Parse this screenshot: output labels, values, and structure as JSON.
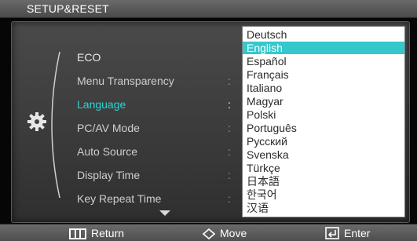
{
  "header": {
    "title": "SETUP&RESET"
  },
  "menu": {
    "items": [
      {
        "label": "ECO"
      },
      {
        "label": "Menu Transparency"
      },
      {
        "label": "Language"
      },
      {
        "label": "PC/AV Mode"
      },
      {
        "label": "Auto Source"
      },
      {
        "label": "Display Time"
      },
      {
        "label": "Key Repeat Time"
      }
    ],
    "active_index": 2,
    "separator": ":"
  },
  "language_dropdown": {
    "options": [
      "Deutsch",
      "English",
      "Español",
      "Français",
      "Italiano",
      "Magyar",
      "Polski",
      "Português",
      "Русский",
      "Svenska",
      "Türkçe",
      "日本語",
      "한국어",
      "汉语"
    ],
    "selected": "English"
  },
  "footer": {
    "return_label": "Return",
    "move_label": "Move",
    "enter_label": "Enter"
  },
  "icons": {
    "category": "gear-icon",
    "more_below": "chevron-down-icon",
    "return": "menu-bars-icon",
    "move": "up-down-icon",
    "enter": "enter-icon"
  },
  "colors": {
    "accent": "#2fd3d3",
    "selection": "#34c8cc",
    "background": "#060606",
    "panel": "#3f3f3f"
  }
}
